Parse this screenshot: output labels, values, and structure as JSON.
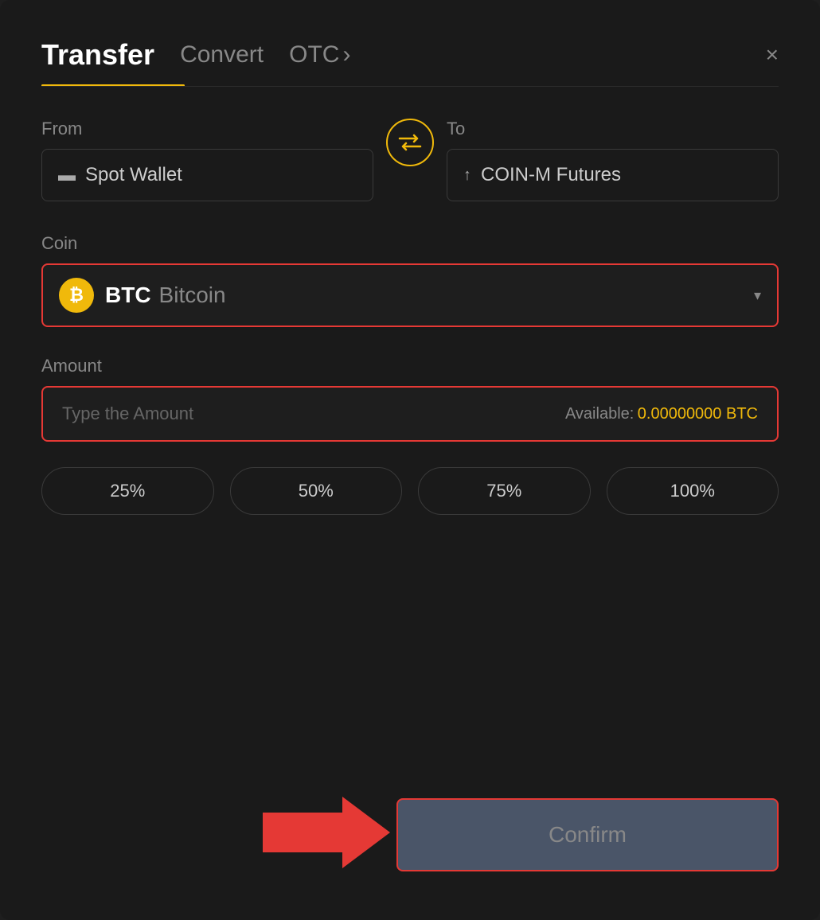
{
  "header": {
    "tab_transfer": "Transfer",
    "tab_convert": "Convert",
    "tab_otc": "OTC",
    "tab_otc_chevron": "›",
    "close_icon": "×"
  },
  "from": {
    "label": "From",
    "wallet_icon": "🪪",
    "wallet_label": "Spot Wallet"
  },
  "swap": {
    "icon": "⇄"
  },
  "to": {
    "label": "To",
    "wallet_icon": "↑",
    "wallet_label": "COIN-M Futures"
  },
  "coin": {
    "label": "Coin",
    "symbol": "BTC",
    "name": "Bitcoin",
    "chevron": "▾"
  },
  "amount": {
    "label": "Amount",
    "placeholder": "Type the Amount",
    "available_label": "Available:",
    "available_value": "0.00000000 BTC"
  },
  "percentages": [
    {
      "label": "25%"
    },
    {
      "label": "50%"
    },
    {
      "label": "75%"
    },
    {
      "label": "100%"
    }
  ],
  "confirm": {
    "label": "Confirm"
  }
}
